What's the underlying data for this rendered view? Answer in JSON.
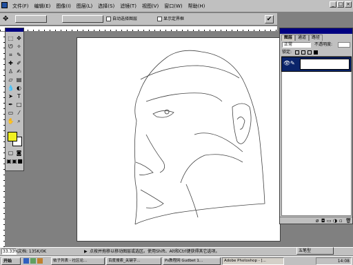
{
  "menubar": {
    "items": [
      "文件(F)",
      "编辑(E)",
      "图像(I)",
      "图层(L)",
      "选择(S)",
      "滤镜(T)",
      "视图(V)",
      "窗口(W)",
      "帮助(H)"
    ],
    "window_controls": [
      "_",
      "□",
      "×"
    ]
  },
  "options": {
    "auto_select_label": "自动选择图层",
    "show_bounds_label": "显示定界框"
  },
  "layers_panel": {
    "tabs": [
      "图层",
      "通道",
      "路径"
    ],
    "blend_mode": "正常",
    "opacity_label": "不透明度:",
    "lock_label": "锁定:",
    "layer_name": ""
  },
  "status": {
    "zoom": "33.33%",
    "doc": "文档: 135K/0K",
    "hint": "点按并拖移以移动图层或选区。使用Shift、Alt和Ctrl键获得其它选项。"
  },
  "ime": {
    "label": "五笔型"
  },
  "taskbar": {
    "start": "开始",
    "tasks": [
      "帖子列表 - 社区论...",
      "百度搜索_关键字...",
      "Ps教程网 Gudbet 1...",
      "Adobe Photoshop - [..."
    ],
    "clock": "14:08"
  },
  "colors": {
    "titlebar": "#000080",
    "foreground": "#f0f020"
  }
}
